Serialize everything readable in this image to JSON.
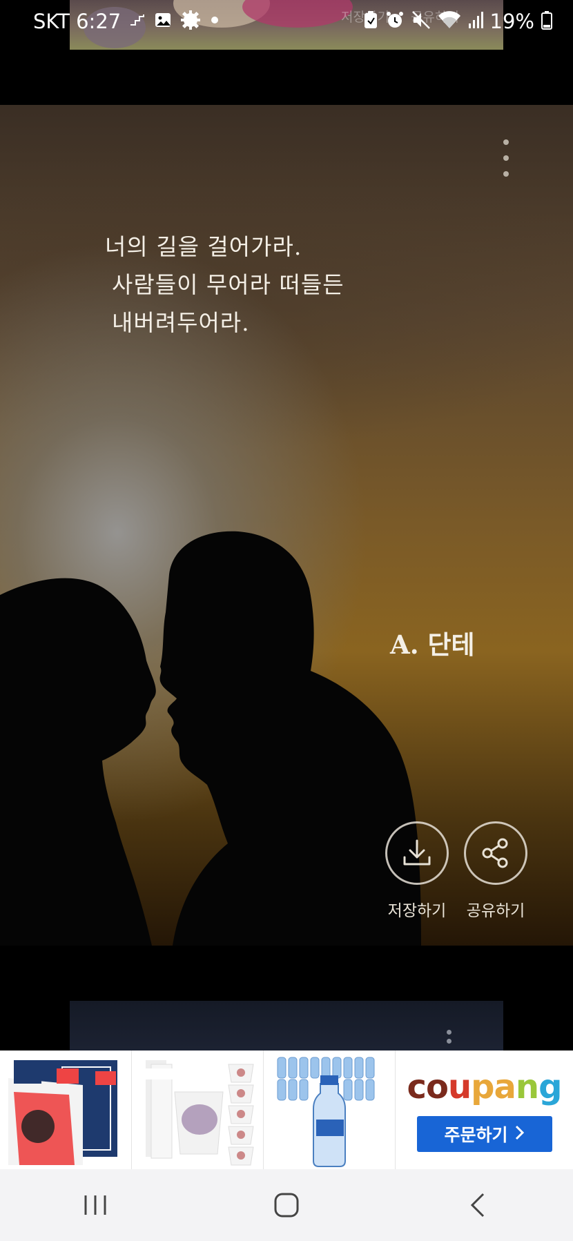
{
  "status_bar": {
    "carrier_time": "SKT 6:27",
    "battery_percent": "19%",
    "icons": [
      "cast-icon",
      "gallery-icon",
      "settings-gear-icon",
      "dot-icon",
      "clipboard-icon",
      "alarm-icon",
      "mute-icon",
      "wifi-icon",
      "signal-icon",
      "battery-icon"
    ]
  },
  "previous_card": {
    "faded_save": "저장하기",
    "faded_share": "공유하기"
  },
  "main_card": {
    "quote_lines": [
      "너의 길을 걸어가라.",
      "사람들이 무어라 떠들든",
      "내버려두어라."
    ],
    "author": "A. 단테",
    "save_label": "저장하기",
    "share_label": "공유하기"
  },
  "ad_banner": {
    "items": [
      "copy-paper-product",
      "paper-cup-product",
      "water-bottle-product"
    ],
    "brand_letters": [
      {
        "ch": "c",
        "color": "#7a2a1c"
      },
      {
        "ch": "o",
        "color": "#7a2a1c"
      },
      {
        "ch": "u",
        "color": "#d53a2a"
      },
      {
        "ch": "p",
        "color": "#e8a73a"
      },
      {
        "ch": "a",
        "color": "#e8a73a"
      },
      {
        "ch": "n",
        "color": "#9ac73a"
      },
      {
        "ch": "g",
        "color": "#2aa6d8"
      }
    ],
    "cta_label": "주문하기",
    "cta_color": "#1865d6"
  },
  "nav_bar": {
    "buttons": [
      "recent-apps-icon",
      "home-icon",
      "back-icon"
    ]
  }
}
